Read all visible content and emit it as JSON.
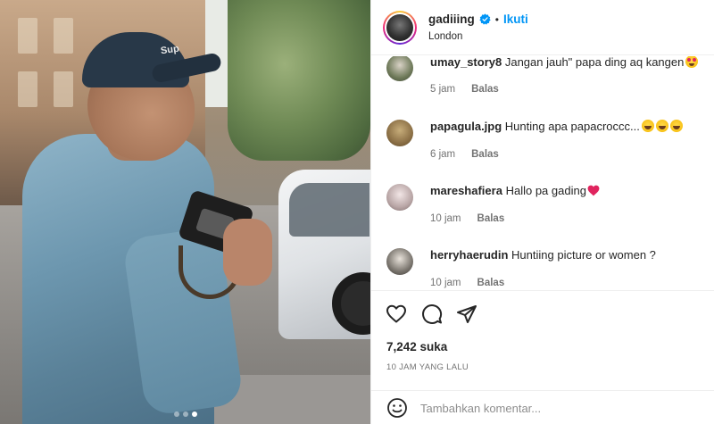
{
  "post": {
    "carousel": {
      "slide_count": 3,
      "active_index": 2
    },
    "photo_cap_text": "Sup"
  },
  "header": {
    "username": "gadiiing",
    "verified": true,
    "separator": "•",
    "follow_label": "Ikuti",
    "location": "London"
  },
  "comments": [
    {
      "user": "umay_story8",
      "text": "Jangan jauh\" papa ding aq kangen",
      "emoji": "heart-eyes",
      "age": "5 jam",
      "reply": "Balas"
    },
    {
      "user": "papagula.jpg",
      "text": "Hunting apa papacroccc...",
      "emoji": "joy x3",
      "age": "6 jam",
      "reply": "Balas"
    },
    {
      "user": "mareshafiera",
      "text": "Hallo pa gading",
      "emoji": "red-heart",
      "age": "10 jam",
      "reply": "Balas"
    },
    {
      "user": "herryhaerudin",
      "text": "Huntiing picture or women ?",
      "emoji": "",
      "age": "10 jam",
      "reply": "Balas"
    }
  ],
  "actions": {
    "icons": [
      "heart-icon",
      "comment-icon",
      "share-icon"
    ],
    "likes": "7,242 suka",
    "timestamp": "10 JAM YANG LALU"
  },
  "add_comment": {
    "icon": "emoji-icon",
    "placeholder": "Tambahkan komentar..."
  },
  "colors": {
    "accent": "#0095f6",
    "text": "#262626",
    "muted": "#737373",
    "heart": "#ed4956"
  }
}
